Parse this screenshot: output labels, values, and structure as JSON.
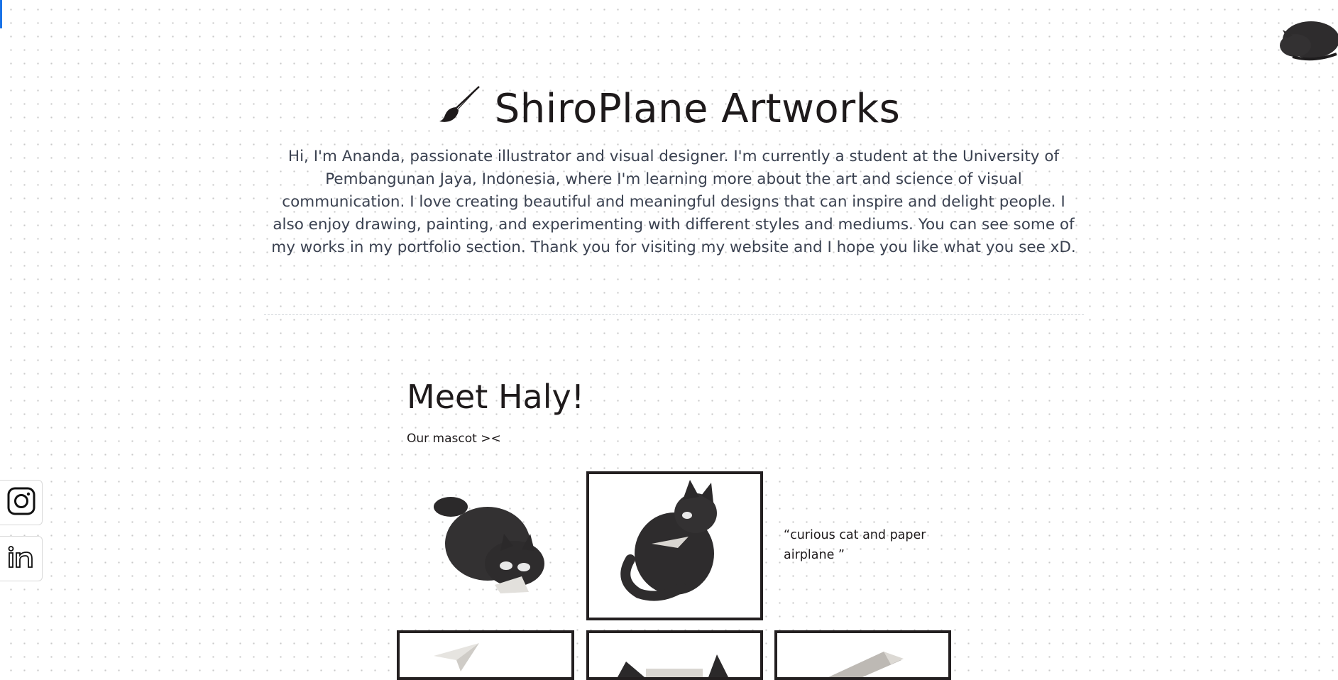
{
  "header": {
    "title": "ShiroPlane Artworks",
    "brush_icon": "paintbrush-icon",
    "intro": "Hi, I'm Ananda, passionate illustrator and visual designer. I'm currently a student at the University of Pembangunan Jaya, Indonesia, where I'm learning more about the art and science of visual communication. I love creating beautiful and meaningful designs that can inspire and delight people. I also enjoy drawing, painting, and experimenting with different styles and mediums. You can see some of my works in my portfolio section. Thank you for visiting my website and I hope you like what you see xD."
  },
  "mascot": {
    "title": "Meet Haly!",
    "subtitle": "Our mascot ><",
    "caption": "“curious cat and paper airplane ”"
  },
  "social": [
    {
      "icon": "instagram-icon"
    },
    {
      "icon": "linkedin-icon"
    }
  ],
  "colors": {
    "text": "#231f20",
    "body_text": "#3a4150",
    "progress": "#1a73e8",
    "frame": "#231f20"
  }
}
